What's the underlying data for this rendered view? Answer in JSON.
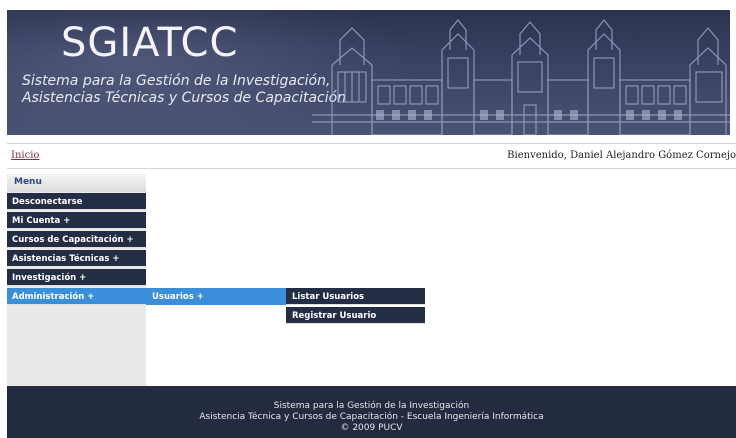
{
  "header": {
    "brand": "SGIATCC",
    "subtitle_line1": "Sistema para la Gestión de la Investigación,",
    "subtitle_line2": "Asistencias Técnicas y Cursos de Capacitación"
  },
  "nav": {
    "home_label": "Inicio",
    "welcome_text": "Bienvenido, Daniel Alejandro Gómez Cornejo"
  },
  "menu": {
    "title": "Menu",
    "items": [
      {
        "label": "Desconectarse"
      },
      {
        "label": "Mi Cuenta +"
      },
      {
        "label": "Cursos de Capacitación +"
      },
      {
        "label": "Asistencias Técnicas +"
      },
      {
        "label": "Investigación +"
      },
      {
        "label": "Administración +"
      }
    ],
    "submenu": {
      "label": "Usuarios +"
    },
    "submenu_items": [
      {
        "label": "Listar Usuarios"
      },
      {
        "label": "Registrar Usuario"
      }
    ]
  },
  "footer": {
    "line1": "Sistema para la Gestión de la Investigación",
    "line2": "Asistencia Técnica y Cursos de Capacitación - Escuela Ingeniería Informática",
    "line3": "© 2009 PUCV"
  }
}
